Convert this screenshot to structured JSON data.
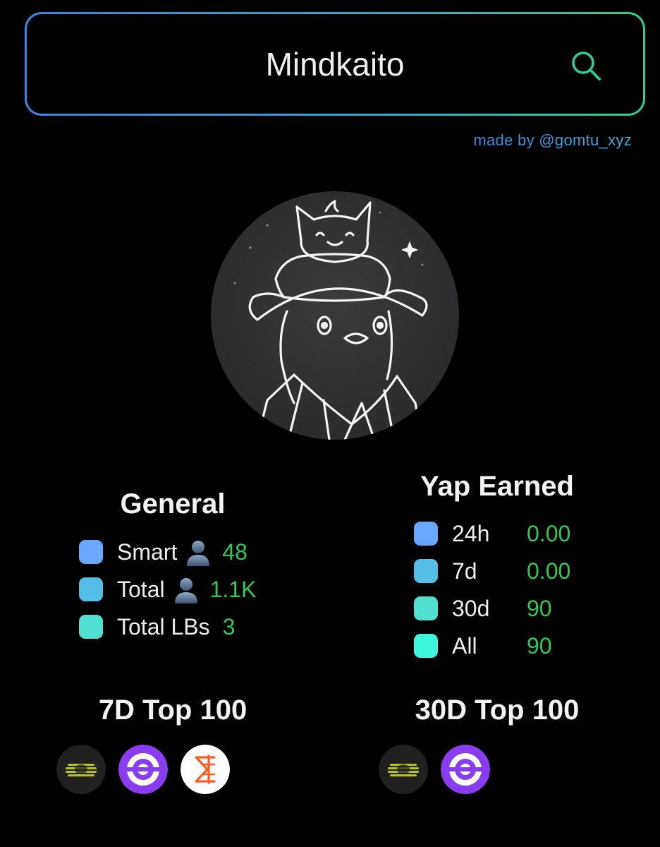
{
  "search": {
    "value": "Mindkaito"
  },
  "credit": "made by @gomtu_xyz",
  "general": {
    "title": "General",
    "rows": [
      {
        "label": "Smart",
        "icon": "person-icon",
        "value": "48",
        "color": "#6aa7ff"
      },
      {
        "label": "Total",
        "icon": "person-icon",
        "value": "1.1K",
        "color": "#55bde6"
      },
      {
        "label": "Total LBs",
        "value": "3",
        "color": "#4fe0cf"
      }
    ]
  },
  "yap": {
    "title": "Yap Earned",
    "rows": [
      {
        "label": "24h",
        "value": "0.00",
        "color": "#6aa7ff"
      },
      {
        "label": "7d",
        "value": "0.00",
        "color": "#55bde6"
      },
      {
        "label": "30d",
        "value": "90",
        "color": "#4fe0cf"
      },
      {
        "label": "All",
        "value": "90",
        "color": "#3ff5dc"
      }
    ]
  },
  "top7d": {
    "title": "7D Top 100",
    "badges": [
      "yellow-stripes-logo",
      "purple-ring-logo",
      "orange-sigma-logo"
    ]
  },
  "top30d": {
    "title": "30D Top 100",
    "badges": [
      "yellow-stripes-logo",
      "purple-ring-logo"
    ]
  },
  "colors": {
    "accent_blue": "#3a86e0",
    "accent_green": "#2fd08d",
    "value_green": "#30c858",
    "background": "#000000"
  }
}
